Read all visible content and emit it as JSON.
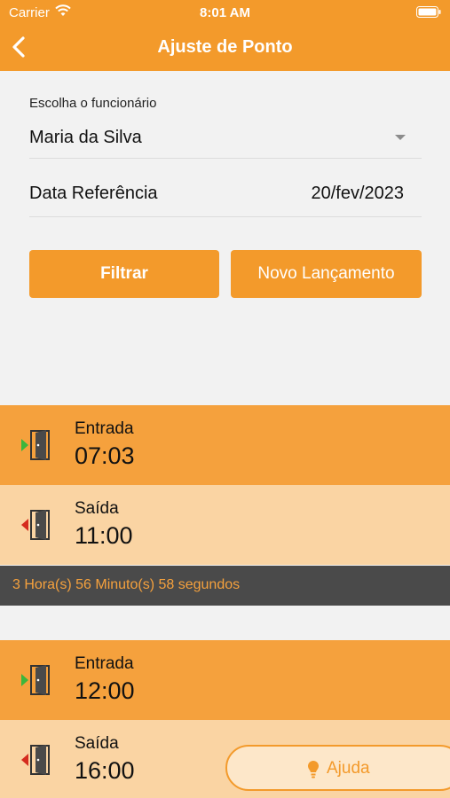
{
  "status": {
    "carrier": "Carrier",
    "time": "8:01 AM"
  },
  "nav": {
    "title": "Ajuste de Ponto"
  },
  "form": {
    "employee_label": "Escolha o funcionário",
    "employee_value": "Maria da Silva",
    "date_label": "Data Referência",
    "date_value": "20/fev/2023",
    "filter_button": "Filtrar",
    "new_button": "Novo Lançamento"
  },
  "groups": [
    {
      "entries": [
        {
          "type": "Entrada",
          "time": "07:03"
        },
        {
          "type": "Saída",
          "time": "11:00"
        }
      ],
      "summary": "3 Hora(s) 56 Minuto(s) 58 segundos"
    },
    {
      "entries": [
        {
          "type": "Entrada",
          "time": "12:00"
        },
        {
          "type": "Saída",
          "time": "16:00"
        }
      ]
    }
  ],
  "help_button": "Ajuda",
  "colors": {
    "accent": "#f39a2b",
    "entry_bg": "#f5a13d",
    "exit_bg": "#fad4a3",
    "summary_bg": "#4a4a4a",
    "entry_arrow": "#3cb63c",
    "exit_arrow": "#d52b1e"
  }
}
